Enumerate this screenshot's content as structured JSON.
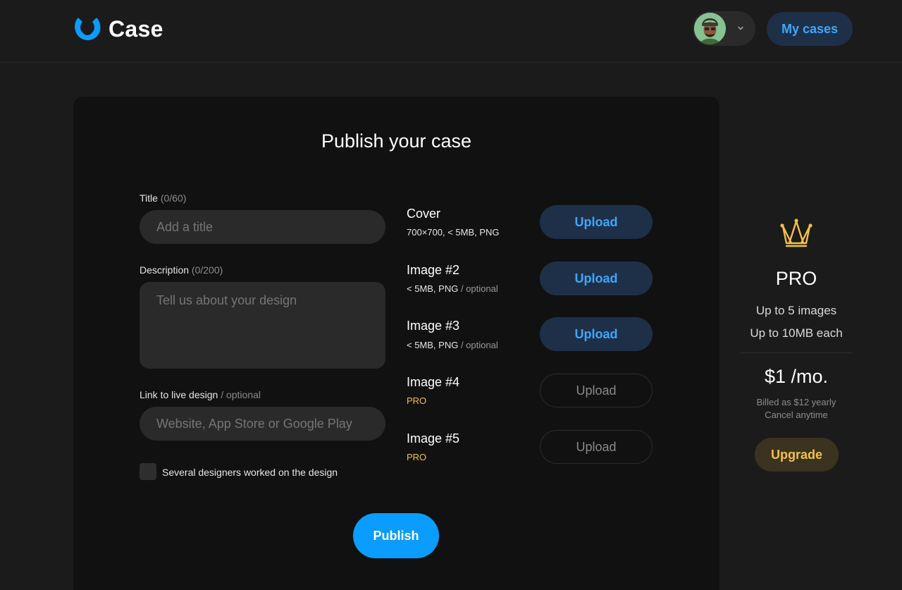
{
  "header": {
    "logo_text": "Case",
    "my_cases_label": "My cases"
  },
  "form": {
    "title": "Publish your case",
    "title_label": "Title",
    "title_count": "(0/60)",
    "title_placeholder": "Add a title",
    "description_label": "Description",
    "description_count": "(0/200)",
    "description_placeholder": "Tell us about your design",
    "link_label": "Link to live design",
    "link_optional": "/ optional",
    "link_placeholder": "Website, App Store or Google Play",
    "several_designers_label": "Several designers worked on the design",
    "publish_label": "Publish"
  },
  "uploads": [
    {
      "title": "Cover",
      "sub": "700×700, < 5MB, PNG",
      "sub_muted": "",
      "button": "Upload"
    },
    {
      "title": "Image #2",
      "sub": "< 5MB, PNG",
      "sub_muted": "/ optional",
      "button": "Upload"
    },
    {
      "title": "Image #3",
      "sub": "< 5MB, PNG",
      "sub_muted": "/ optional",
      "button": "Upload"
    },
    {
      "title": "Image #4",
      "sub": "PRO",
      "sub_muted": "",
      "button": "Upload"
    },
    {
      "title": "Image #5",
      "sub": "PRO",
      "sub_muted": "",
      "button": "Upload"
    }
  ],
  "pro": {
    "title": "PRO",
    "features": [
      "Up to 5 images",
      "Up to 10MB each"
    ],
    "price": "$1 /mo.",
    "billed": "Billed as $12 yearly",
    "cancel": "Cancel anytime",
    "upgrade_label": "Upgrade"
  },
  "colors": {
    "accent_blue": "#0a9cff",
    "link_blue": "#3da7ff",
    "pro_gold": "#f5c045",
    "background": "#1b1b1b",
    "card": "#111111"
  }
}
